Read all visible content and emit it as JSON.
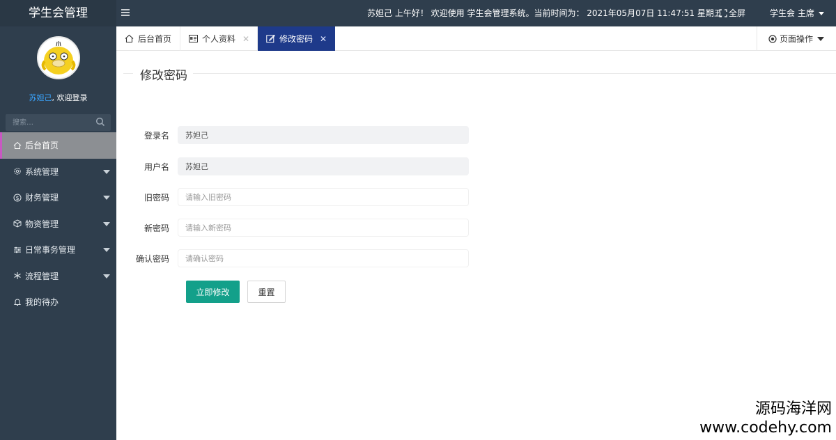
{
  "app": {
    "title": "学生会管理"
  },
  "user": {
    "name": "苏妲己",
    "welcome_suffix": ", 欢迎登录"
  },
  "sidebar": {
    "search_placeholder": "搜索…",
    "items": [
      {
        "label": "后台首页",
        "icon": "home-icon",
        "active": true
      },
      {
        "label": "系统管理",
        "icon": "gear-icon",
        "has_submenu": true
      },
      {
        "label": "财务管理",
        "icon": "dollar-icon",
        "has_submenu": true
      },
      {
        "label": "物资管理",
        "icon": "box-icon",
        "has_submenu": true
      },
      {
        "label": "日常事务管理",
        "icon": "sliders-icon",
        "has_submenu": true
      },
      {
        "label": "流程管理",
        "icon": "flow-icon",
        "has_submenu": true
      },
      {
        "label": "我的待办",
        "icon": "bell-icon"
      }
    ]
  },
  "topbar": {
    "greeting": "苏妲己 上午好！ 欢迎使用 学生会管理系统。当前时间为： 2021年05月07日 11:47:51    星期五",
    "fullscreen_label": "全屏",
    "user_role": "学生会 主席"
  },
  "tabs": [
    {
      "label": "后台首页",
      "icon": "home-icon",
      "closable": false,
      "active": false
    },
    {
      "label": "个人资料",
      "icon": "id-card-icon",
      "closable": true,
      "active": false
    },
    {
      "label": "修改密码",
      "icon": "edit-icon",
      "closable": true,
      "active": true
    }
  ],
  "page_ops": {
    "label": "页面操作"
  },
  "form": {
    "title": "修改密码",
    "fields": [
      {
        "label": "登录名",
        "value": "苏妲己",
        "placeholder": "",
        "readonly": true
      },
      {
        "label": "用户名",
        "value": "苏妲己",
        "placeholder": "",
        "readonly": true
      },
      {
        "label": "旧密码",
        "value": "",
        "placeholder": "请输入旧密码",
        "readonly": false
      },
      {
        "label": "新密码",
        "value": "",
        "placeholder": "请输入新密码",
        "readonly": false
      },
      {
        "label": "确认密码",
        "value": "",
        "placeholder": "请确认密码",
        "readonly": false
      }
    ],
    "submit_label": "立即修改",
    "reset_label": "重置"
  },
  "watermark": {
    "line1": "源码海洋网",
    "line2": "www.codehy.com"
  },
  "colors": {
    "sidebar_bg": "#2f3e4d",
    "active_tab": "#1e3a8a",
    "submit": "#13a08a",
    "active_menu_border": "#c858c2"
  }
}
